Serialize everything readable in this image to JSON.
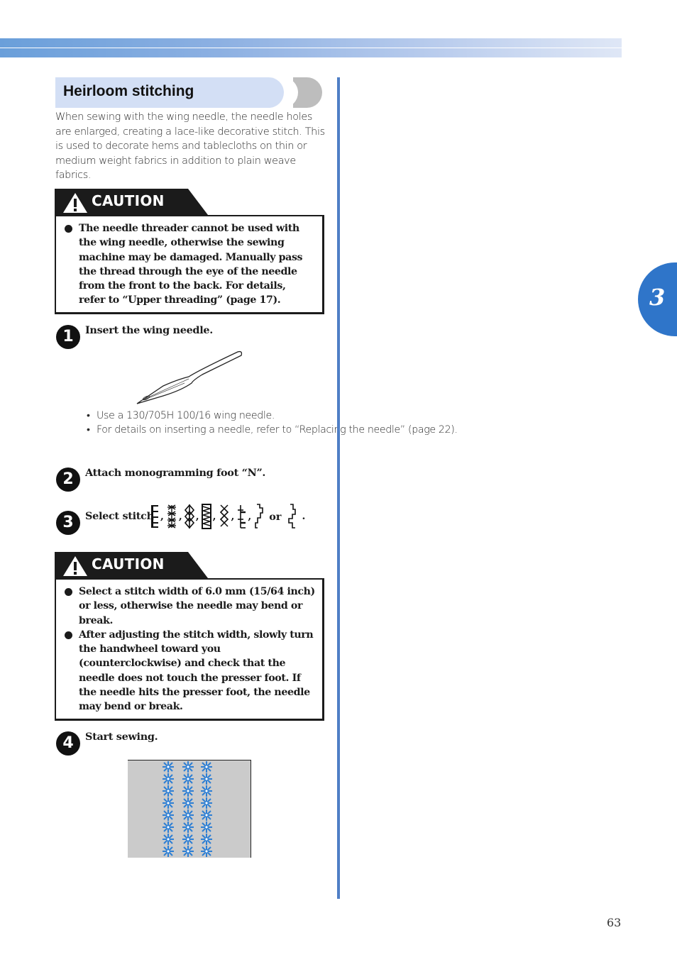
{
  "header": {
    "chapter_number": "3",
    "page_number": "63"
  },
  "section": {
    "title": "Heirloom stitching",
    "intro": "When sewing with the wing needle, the needle holes are enlarged, creating a lace-like decorative stitch. This is used to decorate hems and tablecloths on thin or medium weight fabrics in addition to plain weave fabrics."
  },
  "caution1": {
    "label": "CAUTION",
    "items": [
      "The needle threader cannot be used with the wing needle, otherwise the sewing machine may be damaged. Manually pass the thread through the eye of the needle from the front to the back. For details, refer to “Upper threading” (page 17)."
    ]
  },
  "steps": [
    {
      "number": "1",
      "text": "Insert the wing needle.",
      "bullets": [
        "Use a 130/705H 100/16 wing needle.",
        "For details on inserting a needle, refer to “Replacing the needle” (page 22)."
      ]
    },
    {
      "number": "2",
      "text": "Attach monogramming foot “N”."
    },
    {
      "number": "3",
      "text": "Select stitch",
      "stitch_icons": [
        "comb-stitch",
        "cross-star-stitch",
        "diamond-chain-stitch",
        "zigzag-column-stitch",
        "lattice-stitch",
        "bar-tack-stitch",
        "step-right-stitch",
        "step-left-stitch"
      ],
      "separator": ",",
      "or_label": "or",
      "end": "."
    },
    {
      "number": "4",
      "text": "Start sewing."
    }
  ],
  "caution2": {
    "label": "CAUTION",
    "items": [
      "Select a stitch width of 6.0 mm (15/64 inch) or less, otherwise the needle may bend or break.",
      "After adjusting the stitch width, slowly turn the handwheel toward you (counterclockwise) and check that the needle does not touch the presser foot. If the needle hits the presser foot, the needle may bend or break."
    ]
  },
  "colors": {
    "accent_blue": "#2f75c9",
    "rule_blue": "#4f7fc6",
    "title_bg": "#d3dff5",
    "stitch_blue": "#2e7fd4",
    "fabric_gray": "#cbcbcb"
  }
}
